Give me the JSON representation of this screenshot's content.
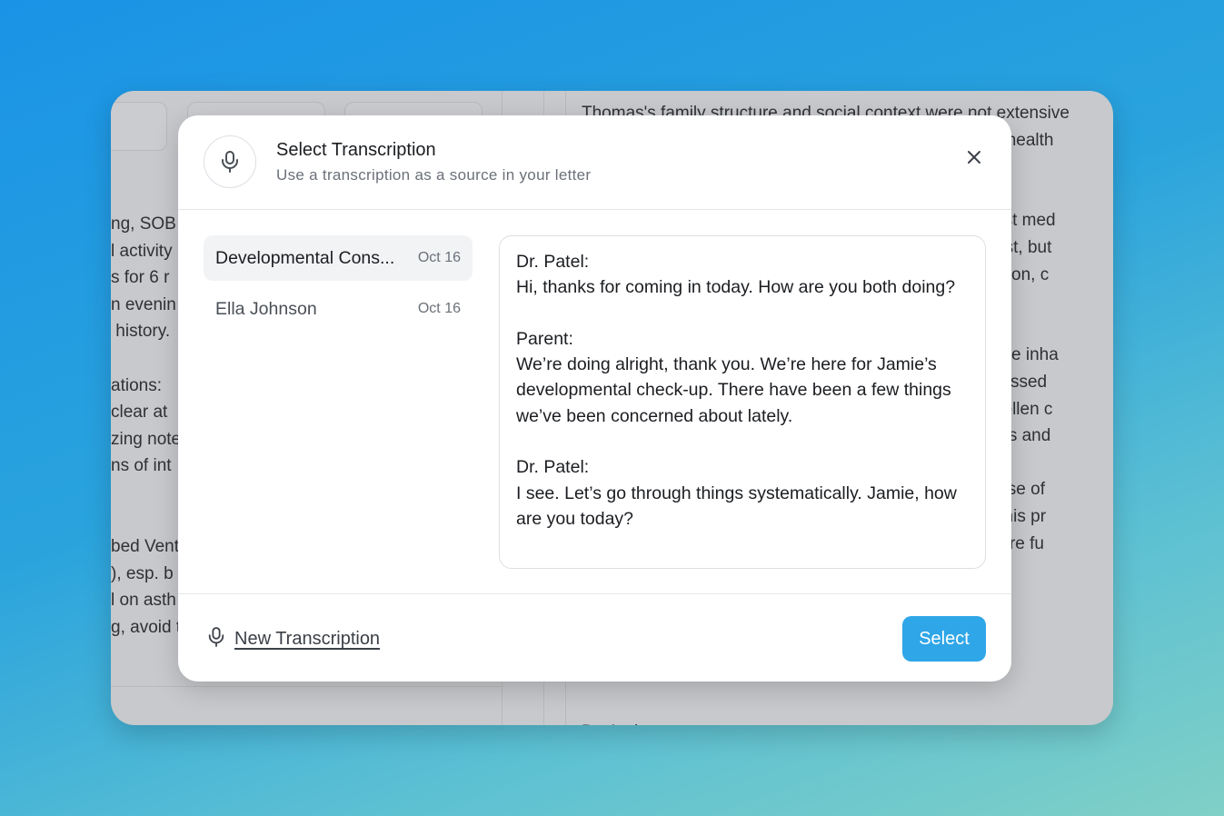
{
  "background": {
    "left_lines": [
      "ng, SOB",
      "l activity",
      "s for 6 r",
      "n evenin",
      " history.",
      "",
      "ations:",
      "clear at",
      "zing note",
      "ns of int",
      "",
      "",
      "bed Vent",
      "), esp. b",
      "l on asth",
      "g, avoid t"
    ],
    "right_lines": [
      "Thomas's family structure and social context were not extensive",
      "                                                                              ng his health",
      "",
      "",
      "                                                                              ant past med",
      "                                                                              n at rest, but",
      "                                                                              g function, c",
      "                                                                              s.",
      "",
      "                                                                              ow-dose inha",
      "                                                                              e discussed",
      "                                                                              h as pollen c",
      "                                                                              mptoms and",
      "",
      "                                                                              s the use of",
      "                                                                              toring his pr",
      "                                                                              there are fu",
      "",
      "",
      "",
      "",
      "",
      "",
      "Dr. Anderson"
    ]
  },
  "modal": {
    "title": "Select Transcription",
    "subtitle": "Use a transcription as a source in your letter",
    "header_icon": "microphone-icon",
    "close_icon": "close-icon"
  },
  "transcriptions": [
    {
      "name": "Developmental Cons...",
      "date": "Oct 16",
      "selected": true
    },
    {
      "name": "Ella Johnson",
      "date": "Oct 16",
      "selected": false
    }
  ],
  "preview": [
    {
      "speaker": "Dr. Patel:",
      "text": "Hi, thanks for coming in today. How are you both doing?"
    },
    {
      "speaker": "Parent:",
      "text": "We’re doing alright, thank you. We’re here for Jamie’s developmental check-up. There have been a few things we’ve been concerned about lately."
    },
    {
      "speaker": "Dr. Patel:",
      "text": "I see. Let’s go through things systematically. Jamie, how are you today?"
    }
  ],
  "footer": {
    "new_transcription_label": "New Transcription",
    "new_transcription_icon": "microphone-icon",
    "select_label": "Select"
  },
  "colors": {
    "accent": "#2fa6e8",
    "overlay": "#c7c9cc"
  }
}
